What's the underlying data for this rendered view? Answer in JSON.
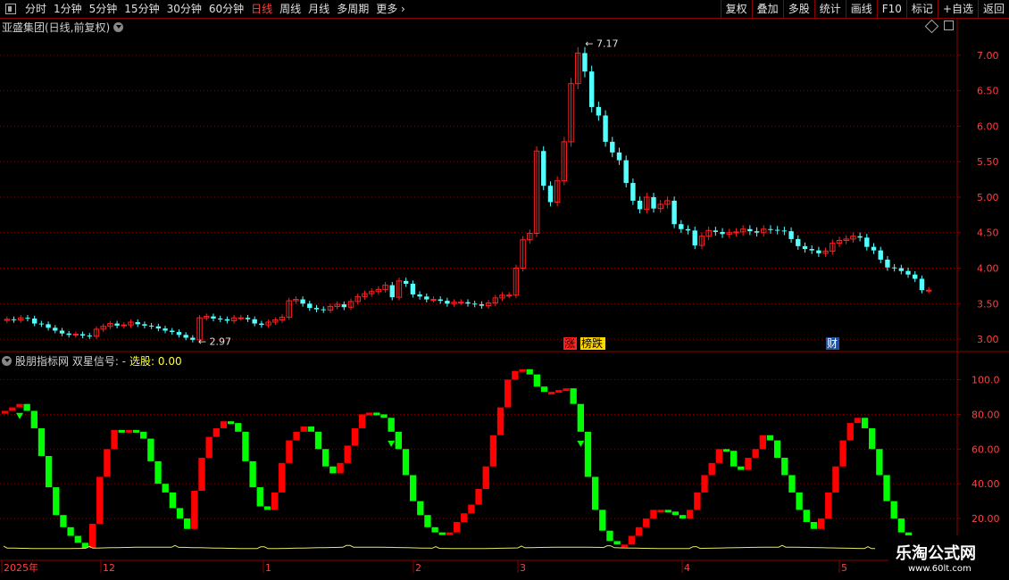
{
  "toolbar": {
    "periods": [
      "分时",
      "1分钟",
      "5分钟",
      "15分钟",
      "30分钟",
      "60分钟",
      "日线",
      "周线",
      "月线",
      "多周期",
      "更多"
    ],
    "active_period": "日线",
    "more_arrow": "›",
    "right_buttons": [
      "复权",
      "叠加",
      "多股",
      "统计",
      "画线",
      "F10",
      "标记",
      "+自选",
      "返回"
    ]
  },
  "main_panel": {
    "title": "亚盛集团(日线,前复权)",
    "high_label": "7.17",
    "low_label": "2.97",
    "event_tags": [
      "涨",
      "榜跌",
      "财"
    ],
    "y_ticks": [
      "7.00",
      "6.50",
      "6.00",
      "5.50",
      "5.00",
      "4.50",
      "4.00",
      "3.50",
      "3.00"
    ]
  },
  "indicator_panel": {
    "title": "股朋指标网 双星信号: -",
    "select_label": "选股: 0.00",
    "y_ticks": [
      "100.0",
      "80.00",
      "60.00",
      "40.00",
      "20.00"
    ]
  },
  "x_axis": {
    "labels": [
      "2025年",
      "12",
      "1",
      "2",
      "3",
      "4",
      "5"
    ]
  },
  "watermark": {
    "name": "乐淘公式网",
    "url": "www.60lt.com"
  },
  "colors": {
    "up": "#ff2020",
    "down": "#54ffff",
    "ind_up": "#ff0000",
    "ind_down": "#00ff00",
    "grid": "#8b0000"
  },
  "chart_data": [
    {
      "type": "candlestick",
      "title": "亚盛集团(日线,前复权)",
      "ylim": [
        2.85,
        7.35
      ],
      "close": [
        3.28,
        3.27,
        3.3,
        3.29,
        3.22,
        3.21,
        3.16,
        3.12,
        3.08,
        3.06,
        3.07,
        3.05,
        3.04,
        3.14,
        3.18,
        3.22,
        3.19,
        3.2,
        3.24,
        3.21,
        3.19,
        3.18,
        3.15,
        3.12,
        3.1,
        3.06,
        3.02,
        2.99,
        3.3,
        3.32,
        3.29,
        3.28,
        3.26,
        3.3,
        3.3,
        3.28,
        3.22,
        3.2,
        3.24,
        3.27,
        3.31,
        3.54,
        3.56,
        3.5,
        3.44,
        3.42,
        3.41,
        3.46,
        3.49,
        3.45,
        3.53,
        3.6,
        3.64,
        3.67,
        3.7,
        3.76,
        3.59,
        3.82,
        3.78,
        3.63,
        3.6,
        3.56,
        3.56,
        3.54,
        3.5,
        3.52,
        3.52,
        3.5,
        3.49,
        3.47,
        3.51,
        3.58,
        3.62,
        3.62,
        4.0,
        4.4,
        4.49,
        5.65,
        5.16,
        4.93,
        5.23,
        5.78,
        6.6,
        7.03,
        6.77,
        6.27,
        6.15,
        5.78,
        5.63,
        5.52,
        5.2,
        4.95,
        4.83,
        5.0,
        4.84,
        4.9,
        4.95,
        4.62,
        4.55,
        4.53,
        4.32,
        4.45,
        4.53,
        4.51,
        4.48,
        4.5,
        4.51,
        4.55,
        4.52,
        4.5,
        4.55,
        4.54,
        4.53,
        4.52,
        4.41,
        4.31,
        4.27,
        4.25,
        4.21,
        4.24,
        4.35,
        4.39,
        4.41,
        4.45,
        4.43,
        4.3,
        4.25,
        4.12,
        4.01,
        4.0,
        3.96,
        3.91,
        3.85,
        3.69,
        3.69
      ],
      "high_mark": 7.17,
      "low_mark": 2.97
    },
    {
      "type": "bar",
      "title": "股朋指标网 双星信号",
      "ylim": [
        0,
        110
      ],
      "values": [
        82,
        84,
        86,
        82,
        72,
        56,
        38,
        22,
        15,
        10,
        6,
        3,
        17,
        44,
        60,
        71,
        70,
        71,
        70,
        66,
        53,
        40,
        35,
        26,
        20,
        14,
        36,
        55,
        67,
        72,
        76,
        75,
        70,
        53,
        38,
        27,
        25,
        35,
        52,
        65,
        70,
        73,
        70,
        60,
        50,
        46,
        52,
        62,
        72,
        80,
        81,
        80,
        78,
        70,
        60,
        45,
        30,
        22,
        15,
        12,
        11,
        12,
        18,
        23,
        28,
        37,
        50,
        68,
        84,
        100,
        105,
        106,
        103,
        96,
        93,
        93,
        94,
        95,
        86,
        70,
        44,
        25,
        13,
        7,
        5,
        5,
        10,
        15,
        20,
        25,
        25,
        24,
        22,
        20,
        25,
        35,
        45,
        52,
        60,
        59,
        50,
        48,
        55,
        60,
        68,
        65,
        55,
        45,
        35,
        25,
        18,
        14,
        20,
        35,
        50,
        65,
        75,
        78,
        72,
        60,
        45,
        30,
        20,
        12,
        8
      ],
      "signals_down_at": [
        2,
        53,
        79
      ]
    }
  ]
}
